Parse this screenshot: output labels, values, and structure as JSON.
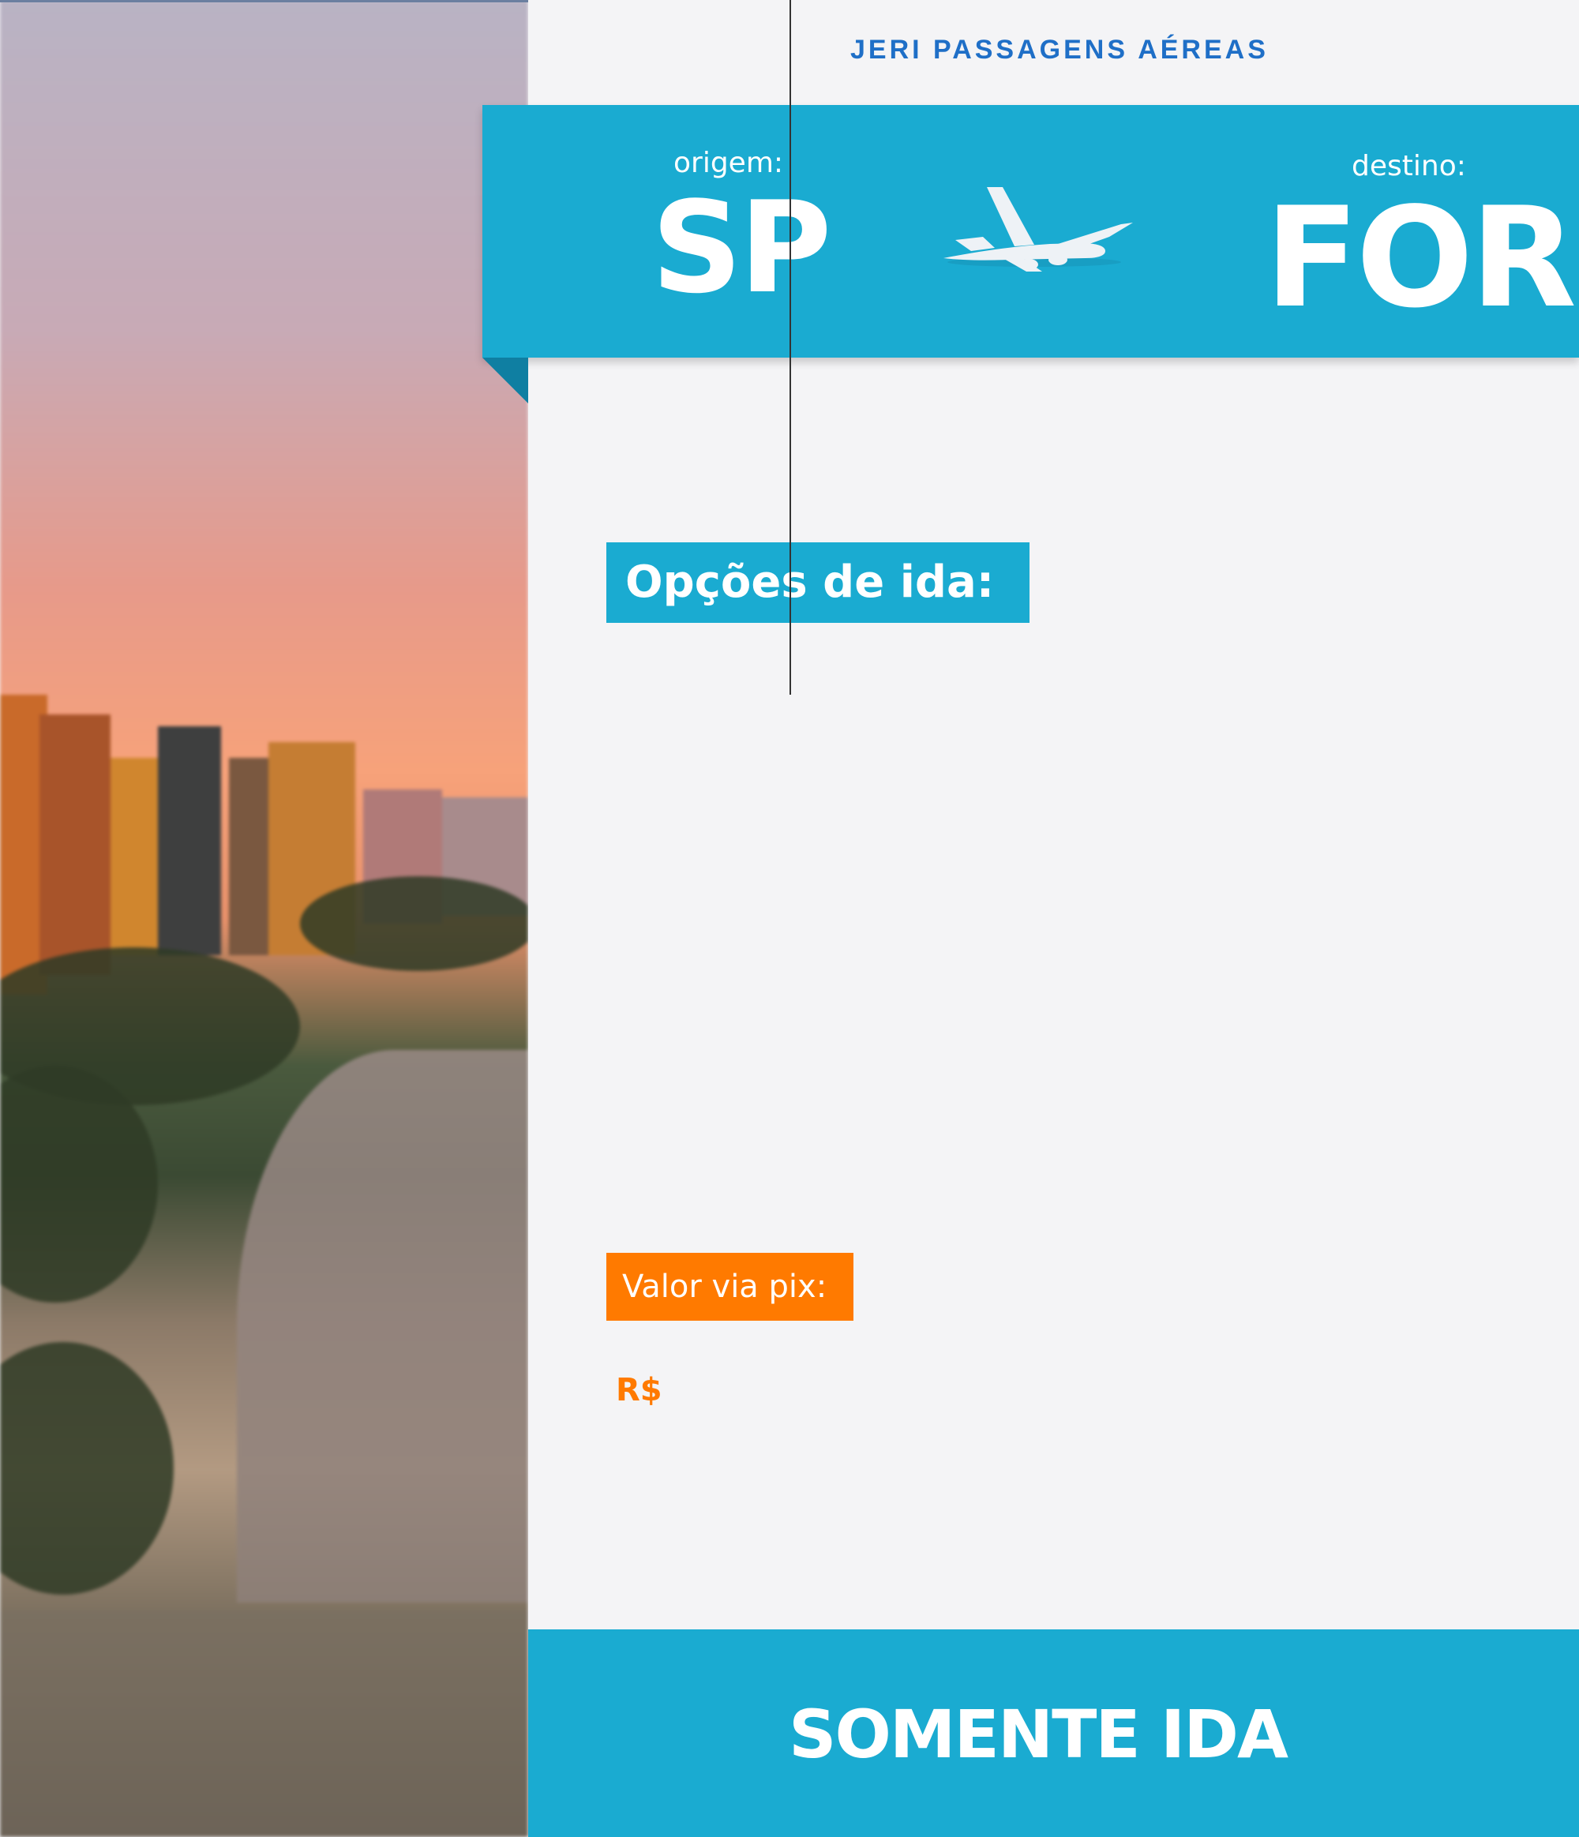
{
  "brand": "JERI PASSAGENS AÉREAS",
  "route": {
    "origin_label": "origem:",
    "origin_code": "SP",
    "destination_label": "destino:",
    "destination_code": "FOR"
  },
  "options_label": "Opções de ida:",
  "price": {
    "label": "Valor via pix:",
    "currency": "R$"
  },
  "footer": {
    "title": "SOMENTE IDA"
  },
  "icons": {
    "plane": "airplane-icon"
  },
  "colors": {
    "primary": "#1aabd1",
    "brand_text": "#1f6fc7",
    "accent": "#ff7a00"
  }
}
